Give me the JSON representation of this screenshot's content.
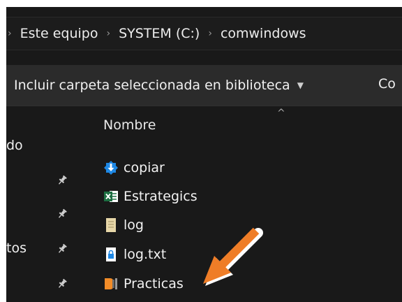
{
  "breadcrumb": {
    "items": [
      "Este equipo",
      "SYSTEM (C:)",
      "comwindows"
    ],
    "separator": "›"
  },
  "ribbon": {
    "include_folder_label": "Incluir carpeta seleccionada en biblioteca",
    "next_label_partial": "Co"
  },
  "nav_pane": {
    "items": [
      {
        "label": "do",
        "pinned": false
      },
      {
        "label": "",
        "pinned": true
      },
      {
        "label": "",
        "pinned": true
      },
      {
        "label": "tos",
        "pinned": true
      },
      {
        "label": "",
        "pinned": true
      }
    ]
  },
  "file_list": {
    "column_header": "Nombre",
    "sort_indicator": "up",
    "files": [
      {
        "name": "copiar",
        "icon": "installer-download-icon"
      },
      {
        "name": "Estrategics",
        "icon": "excel-file-icon"
      },
      {
        "name": "log",
        "icon": "text-document-icon"
      },
      {
        "name": "log.txt",
        "icon": "locked-text-file-icon"
      },
      {
        "name": "Practicas",
        "icon": "project-app-icon"
      }
    ]
  },
  "colors": {
    "window_background": "#191919",
    "ribbon_background": "#2b2b2b",
    "text": "#f0f0f0",
    "annotation_arrow": "#ef7d27"
  },
  "annotation": {
    "type": "arrow",
    "target": "Practicas"
  }
}
